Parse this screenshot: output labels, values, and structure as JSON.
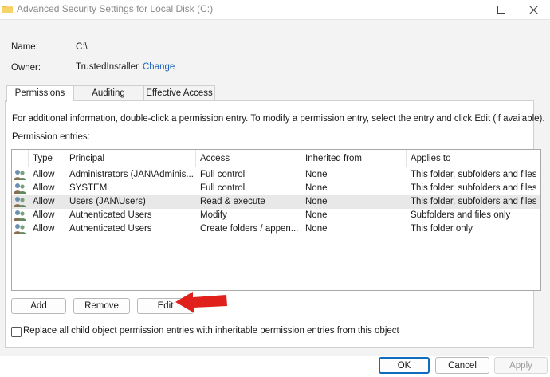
{
  "window": {
    "title": "Advanced Security Settings for Local Disk (C:)"
  },
  "info": {
    "name_label": "Name:",
    "name_value": "C:\\",
    "owner_label": "Owner:",
    "owner_value": "TrustedInstaller",
    "change_link": "Change"
  },
  "tabs": [
    {
      "label": "Permissions",
      "active": true
    },
    {
      "label": "Auditing",
      "active": false
    },
    {
      "label": "Effective Access",
      "active": false
    }
  ],
  "panel": {
    "hint": "For additional information, double-click a permission entry. To modify a permission entry, select the entry and click Edit (if available).",
    "entries_label": "Permission entries:"
  },
  "table": {
    "columns": [
      "Type",
      "Principal",
      "Access",
      "Inherited from",
      "Applies to"
    ],
    "rows": [
      {
        "type": "Allow",
        "principal": "Administrators (JAN\\Adminis...",
        "access": "Full control",
        "inherited": "None",
        "applies": "This folder, subfolders and files",
        "selected": false
      },
      {
        "type": "Allow",
        "principal": "SYSTEM",
        "access": "Full control",
        "inherited": "None",
        "applies": "This folder, subfolders and files",
        "selected": false
      },
      {
        "type": "Allow",
        "principal": "Users (JAN\\Users)",
        "access": "Read & execute",
        "inherited": "None",
        "applies": "This folder, subfolders and files",
        "selected": true
      },
      {
        "type": "Allow",
        "principal": "Authenticated Users",
        "access": "Modify",
        "inherited": "None",
        "applies": "Subfolders and files only",
        "selected": false
      },
      {
        "type": "Allow",
        "principal": "Authenticated Users",
        "access": "Create folders / appen...",
        "inherited": "None",
        "applies": "This folder only",
        "selected": false
      }
    ]
  },
  "actions": {
    "add": "Add",
    "remove": "Remove",
    "edit": "Edit"
  },
  "replace_checkbox": {
    "label": "Replace all child object permission entries with inheritable permission entries from this object",
    "checked": false
  },
  "footer": {
    "ok": "OK",
    "cancel": "Cancel",
    "apply": "Apply"
  },
  "colors": {
    "accent": "#0f6cbd",
    "link": "#1a63b8",
    "annotation_arrow": "#e0201b",
    "selected_row": "#e8e8e8"
  }
}
